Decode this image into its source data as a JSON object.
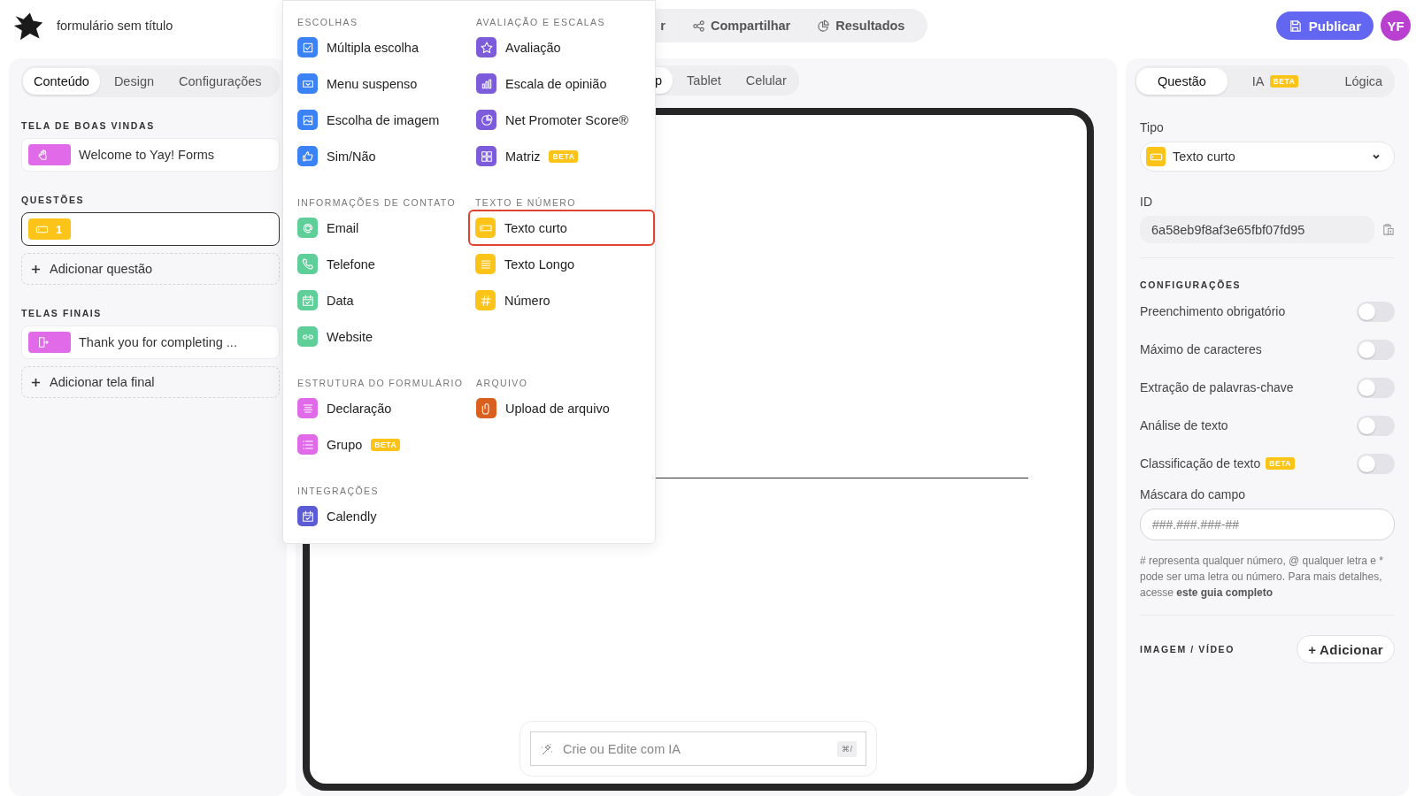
{
  "header": {
    "title": "formulário sem título",
    "nav": [
      {
        "label": "r"
      },
      {
        "label": "Compartilhar"
      },
      {
        "label": "Resultados"
      }
    ],
    "publish": "Publicar",
    "avatar": "YF"
  },
  "left_panel": {
    "tabs": [
      {
        "label": "Conteúdo",
        "selected": true
      },
      {
        "label": "Design",
        "selected": false
      },
      {
        "label": "Configurações",
        "selected": false
      }
    ],
    "welcome_heading": "TELA DE BOAS VINDAS",
    "welcome": {
      "label": "Welcome to Yay! Forms",
      "color": "#e06ae8"
    },
    "questions_heading": "QUESTÕES",
    "questions": [
      {
        "number": "1",
        "color": "#fcc419",
        "selected": true
      }
    ],
    "add_question": "Adicionar questão",
    "endings_heading": "TELAS FINAIS",
    "endings": [
      {
        "label": "Thank you for completing ...",
        "color": "#e06ae8"
      }
    ],
    "add_ending": "Adicionar tela final"
  },
  "preview": {
    "device_tabs": [
      {
        "label": "p",
        "selected": true
      },
      {
        "label": "Tablet",
        "selected": false
      },
      {
        "label": "Celular",
        "selected": false
      }
    ],
    "ai_placeholder": "Crie ou Edite com IA",
    "ai_shortcut": "⌘/"
  },
  "type_menu": {
    "sections": [
      {
        "heading": "ESCOLHAS",
        "items": [
          {
            "label": "Múltipla escolha",
            "color": "#3b82f6",
            "selected": false
          },
          {
            "label": "Menu suspenso",
            "color": "#3b82f6",
            "selected": false
          },
          {
            "label": "Escolha de imagem",
            "color": "#3b82f6",
            "selected": false
          },
          {
            "label": "Sim/Não",
            "color": "#3b82f6",
            "selected": false
          }
        ]
      },
      {
        "heading": "AVALIAÇÃO E ESCALAS",
        "items": [
          {
            "label": "Avaliação",
            "color": "#7c5cdb",
            "selected": false
          },
          {
            "label": "Escala de opinião",
            "color": "#7c5cdb",
            "selected": false
          },
          {
            "label": "Net Promoter Score®",
            "color": "#7c5cdb",
            "selected": false
          },
          {
            "label": "Matriz",
            "color": "#7c5cdb",
            "selected": false,
            "badge": "BETA"
          }
        ]
      },
      {
        "heading": "INFORMAÇÕES DE CONTATO",
        "items": [
          {
            "label": "Email",
            "color": "#5fcf9a",
            "selected": false
          },
          {
            "label": "Telefone",
            "color": "#5fcf9a",
            "selected": false
          },
          {
            "label": "Data",
            "color": "#5fcf9a",
            "selected": false
          },
          {
            "label": "Website",
            "color": "#5fcf9a",
            "selected": false
          }
        ]
      },
      {
        "heading": "TEXTO E NÚMERO",
        "items": [
          {
            "label": "Texto curto",
            "color": "#fcc419",
            "selected": true
          },
          {
            "label": "Texto Longo",
            "color": "#fcc419",
            "selected": false
          },
          {
            "label": "Número",
            "color": "#fcc419",
            "selected": false
          }
        ]
      },
      {
        "heading": "ESTRUTURA DO FORMULÁRIO",
        "items": [
          {
            "label": "Declaração",
            "color": "#e06ae8",
            "selected": false
          },
          {
            "label": "Grupo",
            "color": "#e06ae8",
            "selected": false,
            "badge": "BETA"
          }
        ]
      },
      {
        "heading": "ARQUIVO",
        "items": [
          {
            "label": "Upload de arquivo",
            "color": "#d9601f",
            "selected": false
          }
        ]
      },
      {
        "heading": "INTEGRAÇÕES",
        "items": [
          {
            "label": "Calendly",
            "color": "#5b5bd6",
            "selected": false
          }
        ]
      }
    ]
  },
  "right_panel": {
    "tabs": [
      {
        "label": "Questão",
        "selected": true
      },
      {
        "label": "IA",
        "selected": false,
        "badge": "BETA"
      },
      {
        "label": "Lógica",
        "selected": false
      }
    ],
    "type_label": "Tipo",
    "type_value": "Texto curto",
    "id_label": "ID",
    "id_value": "6a58eb9f8af3e65fbf07fd95",
    "settings_heading": "CONFIGURAÇÕES",
    "settings": [
      {
        "label": "Preenchimento obrigatório",
        "on": false
      },
      {
        "label": "Máximo de caracteres",
        "on": false
      },
      {
        "label": "Extração de palavras-chave",
        "on": false
      },
      {
        "label": "Análise de texto",
        "on": false
      },
      {
        "label": "Classificação de texto",
        "on": false,
        "badge": "BETA"
      }
    ],
    "mask_label": "Máscara do campo",
    "mask_placeholder": "###.###.###-##",
    "help_text": "# representa qualquer número, @ qualquer letra e * pode ser uma letra ou número. Para mais detalhes, acesse",
    "help_link": "este guia completo",
    "media_heading": "IMAGEM / VÍDEO",
    "add_media": "+ Adicionar"
  }
}
